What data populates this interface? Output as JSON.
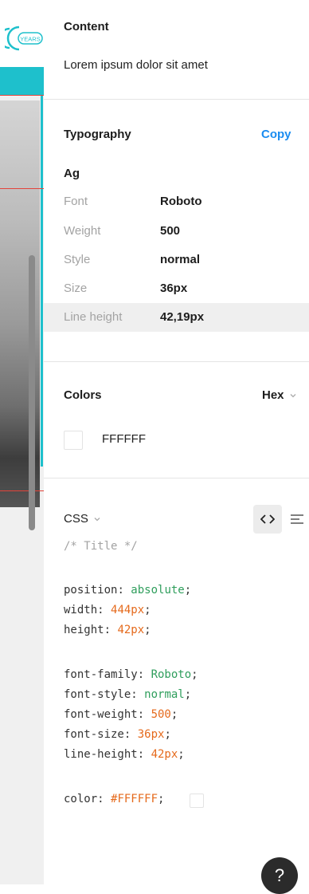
{
  "canvas": {
    "logo_text": "YEARS",
    "colors": {
      "teal": "#1ec0cc",
      "guide_red": "#e3443b"
    }
  },
  "content": {
    "title": "Content",
    "value": "Lorem ipsum dolor sit amet"
  },
  "typography": {
    "title": "Typography",
    "copy_label": "Copy",
    "sample": "Ag",
    "rows": [
      {
        "label": "Font",
        "value": "Roboto"
      },
      {
        "label": "Weight",
        "value": "500"
      },
      {
        "label": "Style",
        "value": "normal"
      },
      {
        "label": "Size",
        "value": "36px"
      },
      {
        "label": "Line height",
        "value": "42,19px"
      }
    ]
  },
  "colors": {
    "title": "Colors",
    "format_label": "Hex",
    "swatch_value": "FFFFFF",
    "swatch_color": "#FFFFFF"
  },
  "css": {
    "title": "CSS",
    "comment": "/* Title */",
    "lines": [
      {
        "prop": "position",
        "value": "absolute",
        "kind": "keyword"
      },
      {
        "prop": "width",
        "value": "444px",
        "kind": "number"
      },
      {
        "prop": "height",
        "value": "42px",
        "kind": "number"
      },
      {
        "prop": "font-family",
        "value": "Roboto",
        "kind": "keyword"
      },
      {
        "prop": "font-style",
        "value": "normal",
        "kind": "keyword"
      },
      {
        "prop": "font-weight",
        "value": "500",
        "kind": "number"
      },
      {
        "prop": "font-size",
        "value": "36px",
        "kind": "number"
      },
      {
        "prop": "line-height",
        "value": "42px",
        "kind": "number"
      },
      {
        "prop": "color",
        "value": "#FFFFFF",
        "kind": "number"
      }
    ],
    "code_view_icon": "code-icon",
    "list_view_icon": "align-lines-icon"
  },
  "help": {
    "label": "?"
  }
}
